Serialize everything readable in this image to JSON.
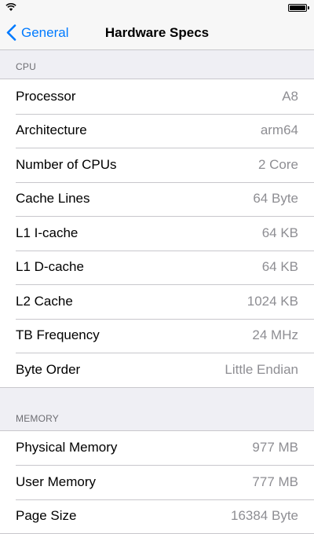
{
  "colors": {
    "background": "#efeff4",
    "accent": "#007aff",
    "value_text": "#8e8e93",
    "separator": "#c8c7cc"
  },
  "status_bar": {
    "icons": [
      "wifi-icon",
      "battery-icon"
    ]
  },
  "nav": {
    "back_label": "General",
    "back_icon": "chevron-left-icon",
    "title": "Hardware Specs"
  },
  "sections": [
    {
      "header": "CPU",
      "rows": [
        {
          "label": "Processor",
          "value": "A8"
        },
        {
          "label": "Architecture",
          "value": "arm64"
        },
        {
          "label": "Number of CPUs",
          "value": "2 Core"
        },
        {
          "label": "Cache Lines",
          "value": "64 Byte"
        },
        {
          "label": "L1 I-cache",
          "value": "64 KB"
        },
        {
          "label": "L1 D-cache",
          "value": "64 KB"
        },
        {
          "label": "L2 Cache",
          "value": "1024 KB"
        },
        {
          "label": "TB Frequency",
          "value": "24 MHz"
        },
        {
          "label": "Byte Order",
          "value": "Little Endian"
        }
      ]
    },
    {
      "header": "MEMORY",
      "rows": [
        {
          "label": "Physical Memory",
          "value": "977 MB"
        },
        {
          "label": "User Memory",
          "value": "777 MB"
        },
        {
          "label": "Page Size",
          "value": "16384 Byte"
        }
      ]
    }
  ]
}
